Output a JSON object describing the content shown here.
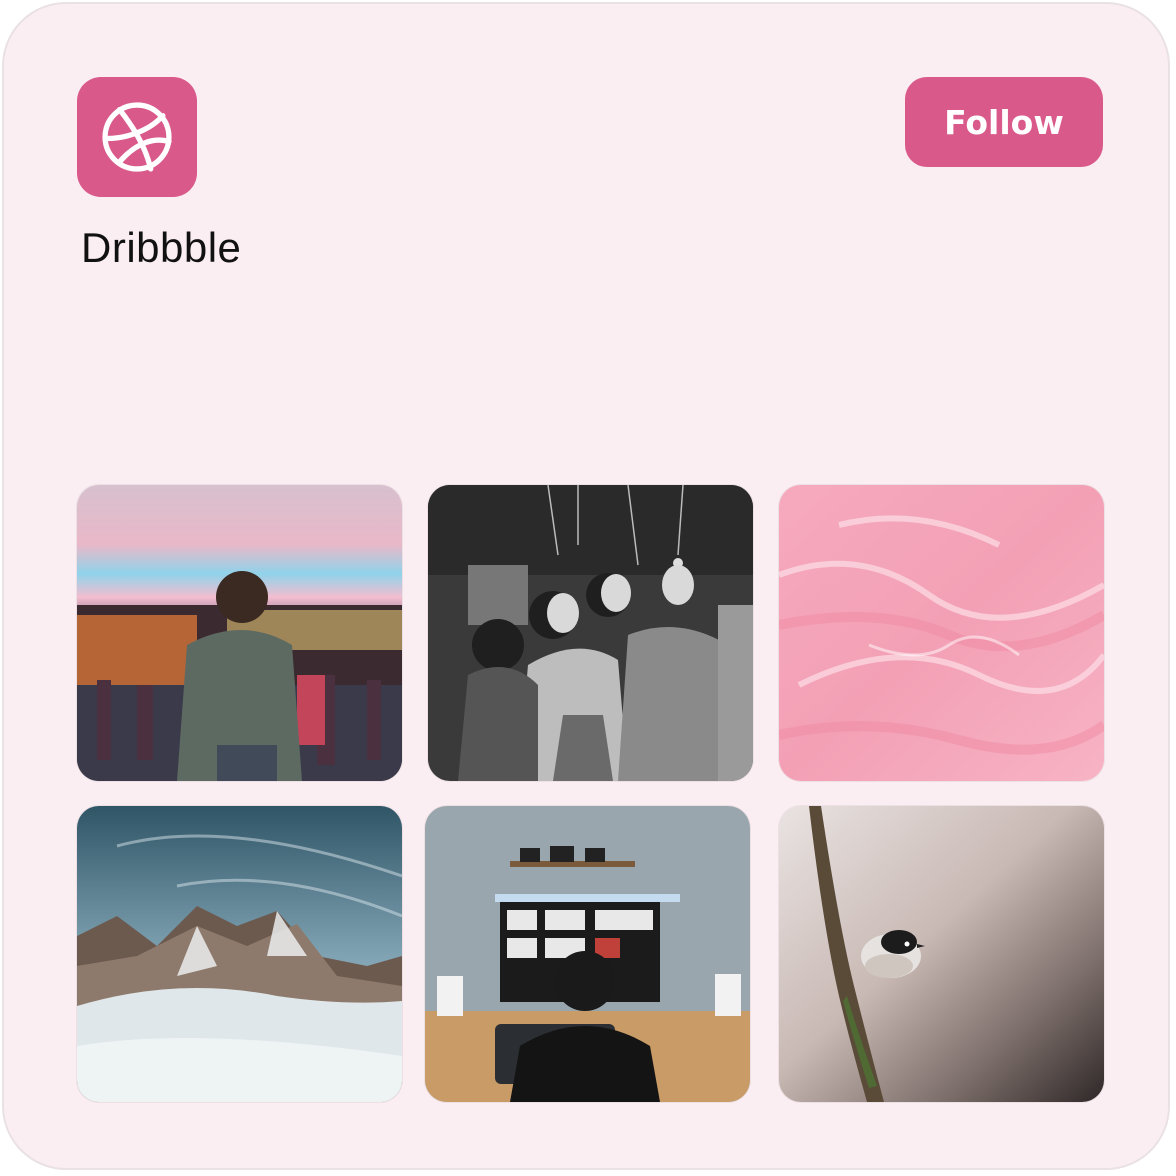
{
  "app": {
    "name": "Dribbble",
    "icon": "dribbble-ball-icon",
    "accent_color": "#d9598a",
    "background_color": "#fbeef3"
  },
  "actions": {
    "follow_label": "Follow"
  },
  "gallery": {
    "tiles": [
      {
        "subject": "man-at-night-festival-photo"
      },
      {
        "subject": "black-and-white-party-photo"
      },
      {
        "subject": "pink-marble-texture-photo"
      },
      {
        "subject": "snowy-mountains-photo"
      },
      {
        "subject": "person-at-desk-setup-photo"
      },
      {
        "subject": "small-bird-on-branch-photo"
      }
    ]
  }
}
